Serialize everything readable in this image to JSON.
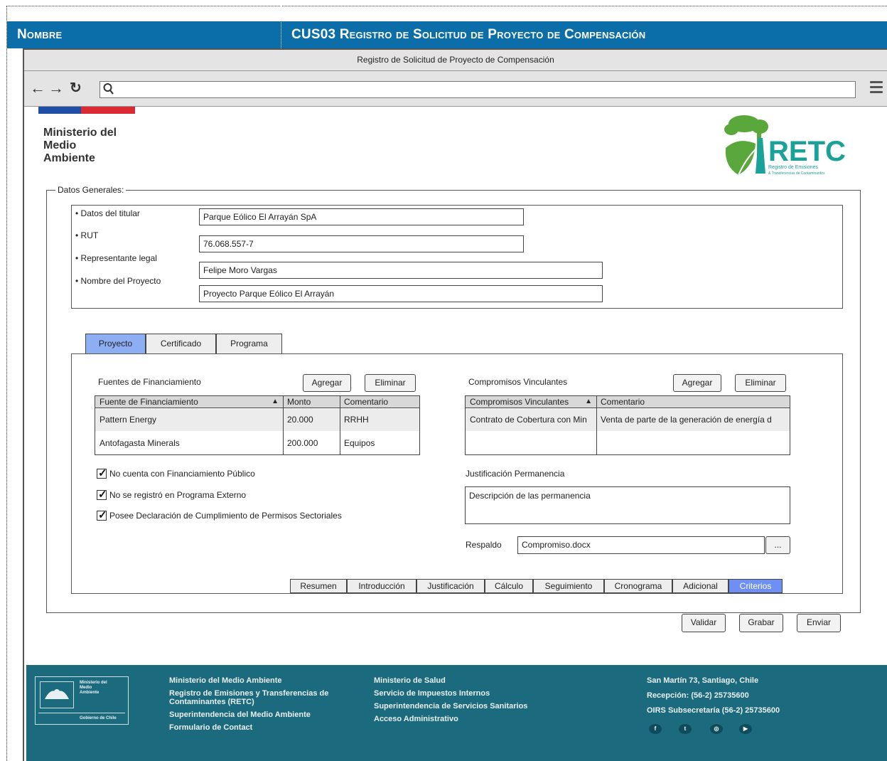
{
  "header": {
    "left_label": "Nombre",
    "right_label": "CUS03 Registro de Solicitud de Proyecto de Compensación"
  },
  "window": {
    "title": "Registro de Solicitud  de Proyecto de Compensación"
  },
  "browser": {
    "icons": [
      "back-arrow-icon",
      "forward-arrow-icon",
      "reload-icon",
      "search-icon",
      "hamburger-menu-icon"
    ],
    "url": ""
  },
  "site": {
    "ministry_line1": "Ministerio del",
    "ministry_line2": "Medio",
    "ministry_line3": "Ambiente",
    "logo_text": "RETC",
    "logo_subtext": "Registro de Emisiones",
    "logo_subtext2": "& Transferencias de Contaminantes"
  },
  "datos_generales": {
    "legend": "Datos Generales:",
    "fields": [
      {
        "label": "• Datos del titular",
        "value": "Parque Eólico El Arrayán SpA"
      },
      {
        "label": "• RUT",
        "value": "76.068.557-7"
      },
      {
        "label": "• Representante legal",
        "value": "Felipe Moro Vargas"
      },
      {
        "label": "• Nombre del Proyecto",
        "value": "Proyecto Parque Eólico El Arrayán"
      }
    ]
  },
  "tabs": [
    {
      "label": "Proyecto",
      "active": true
    },
    {
      "label": "Certificado",
      "active": false
    },
    {
      "label": "Programa",
      "active": false
    }
  ],
  "financiamiento": {
    "title": "Fuentes de Financiamiento",
    "add_label": "Agregar",
    "remove_label": "Eliminar",
    "columns": [
      "Fuente de Financiamiento",
      "Monto",
      "Comentario"
    ],
    "sort_indicator": "▲",
    "rows": [
      [
        "Pattern Energy",
        "20.000",
        "RRHH"
      ],
      [
        "Antofagasta Minerals",
        "200.000",
        "Equipos"
      ]
    ]
  },
  "compromisos": {
    "title": "Compromisos Vinculantes",
    "add_label": "Agregar",
    "remove_label": "Eliminar",
    "columns": [
      "Compromisos Vinculantes",
      "Comentario"
    ],
    "sort_indicator": "▲",
    "rows": [
      [
        "Contrato de Cobertura con Min",
        "Venta de parte de la generación de energía d"
      ]
    ]
  },
  "checkboxes": [
    {
      "label": "No cuenta con Financiamiento Público",
      "checked": true
    },
    {
      "label": "No se registró en Programa Externo",
      "checked": true
    },
    {
      "label": "Posee Declaración de Cumplimiento de Permisos Sectoriales",
      "checked": true
    }
  ],
  "justificacion": {
    "label": "Justificación Permanencia",
    "value": "Descripción de las permanencia"
  },
  "respaldo": {
    "label": "Respaldo",
    "value": "Compromiso.docx",
    "browse_label": "..."
  },
  "bottom_tabs": [
    {
      "label": "Resumen",
      "active": false
    },
    {
      "label": "Introducción",
      "active": false
    },
    {
      "label": "Justificación",
      "active": false
    },
    {
      "label": "Cálculo",
      "active": false
    },
    {
      "label": "Seguimiento",
      "active": false
    },
    {
      "label": "Cronograma",
      "active": false
    },
    {
      "label": "Adicional",
      "active": false
    },
    {
      "label": "Criterios",
      "active": true
    }
  ],
  "actions": {
    "validar": "Validar",
    "grabar": "Grabar",
    "enviar": "Enviar"
  },
  "footer": {
    "logo_text1": "Ministerio del",
    "logo_text2": "Medio",
    "logo_text3": "Ambiente",
    "logo_text4": "Gobierno de Chile",
    "col1": [
      "Ministerio del Medio Ambiente",
      "Registro de Emisiones y Transferencias de Contaminantes (RETC)",
      "Superintendencia del Medio Ambiente",
      "Formulario de Contact"
    ],
    "col2": [
      "Ministerio de Salud",
      "Servicio de Impuestos Internos",
      "Superintendencia de Servicios Sanitarios",
      "Acceso Administrativo"
    ],
    "col3": [
      "San Martín 73, Santiago, Chile",
      "Recepción: (56-2) 25735600",
      "OIRS Subsecretaría (56-2) 25735600"
    ],
    "social": [
      {
        "icon": "facebook-icon",
        "glyph": "f"
      },
      {
        "icon": "twitter-icon",
        "glyph": "t"
      },
      {
        "icon": "instagram-icon",
        "glyph": "◎"
      },
      {
        "icon": "youtube-icon",
        "glyph": "▶"
      }
    ]
  },
  "colors": {
    "header_band": "#0b6ea8",
    "active_tab": "#8eaef3",
    "active_bottom_tab": "#6e8ff3",
    "footer": "#1b6a7e",
    "logo_green": "#5aa83c",
    "logo_teal": "#1aa19a"
  }
}
